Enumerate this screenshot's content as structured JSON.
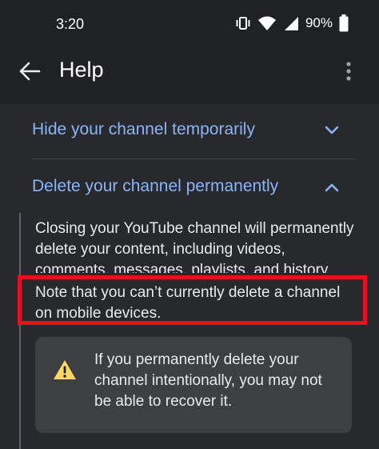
{
  "status_bar": {
    "time": "3:20",
    "battery_percent": "90%",
    "icons": [
      "vibrate-icon",
      "wifi-icon",
      "cellular-signal-icon",
      "battery-icon"
    ]
  },
  "app_bar": {
    "title": "Help",
    "back_icon": "arrow-back-icon",
    "menu_icon": "more-vertical-icon"
  },
  "sections": [
    {
      "label": "Hide your channel temporarily",
      "state": "collapsed",
      "icon": "chevron-down-icon"
    },
    {
      "label": "Delete your channel permanently",
      "state": "expanded",
      "icon": "chevron-up-icon"
    }
  ],
  "expanded_content": {
    "paragraph1": "Closing your YouTube channel will permanently delete your content, including videos, comments, messages, playlists, and history.",
    "paragraph2": "Note that you can’t currently delete a channel on mobile devices.",
    "warning": {
      "icon": "warning-icon",
      "text": "If you permanently delete your channel intentionally, you may not be able to recover it."
    }
  },
  "colors": {
    "background": "#202124",
    "content_background": "#28292c",
    "link_blue": "#8ab4f8",
    "highlight_red": "#e0131f",
    "warning_yellow": "#fdd663",
    "card_background": "#3c4043"
  }
}
